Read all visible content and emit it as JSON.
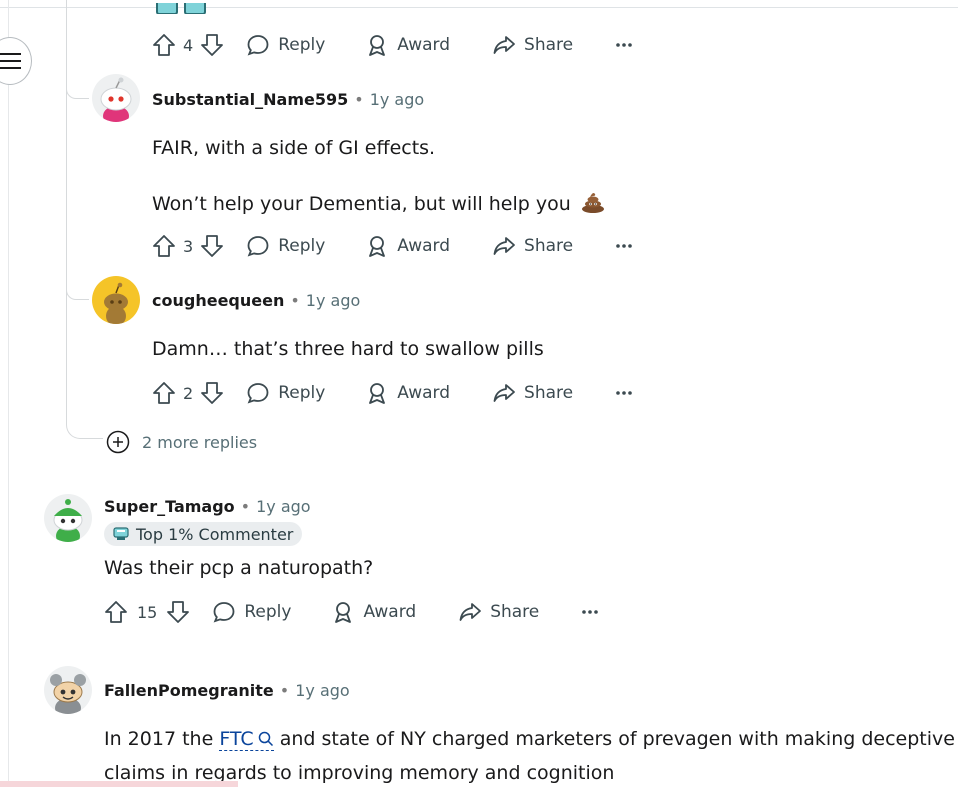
{
  "nav": {
    "menu_icon": "hamburger-icon"
  },
  "comments": [
    {
      "vote_count": "4",
      "actions": {
        "reply": "Reply",
        "award": "Award",
        "share": "Share"
      }
    },
    {
      "username": "Substantial_Name595",
      "separator": "•",
      "time": "1y ago",
      "paragraphs": [
        "FAIR, with a side of GI effects.",
        "Won’t help your Dementia, but will help you"
      ],
      "emoji": "💩",
      "vote_count": "3",
      "actions": {
        "reply": "Reply",
        "award": "Award",
        "share": "Share"
      }
    },
    {
      "username": "cougheequeen",
      "separator": "•",
      "time": "1y ago",
      "paragraphs": [
        "Damn… that’s three hard to swallow pills"
      ],
      "vote_count": "2",
      "actions": {
        "reply": "Reply",
        "award": "Award",
        "share": "Share"
      }
    },
    {
      "username": "Super_Tamago",
      "separator": "•",
      "time": "1y ago",
      "badge": "Top 1% Commenter",
      "paragraphs": [
        "Was their pcp a naturopath?"
      ],
      "vote_count": "15",
      "actions": {
        "reply": "Reply",
        "award": "Award",
        "share": "Share"
      }
    },
    {
      "username": "FallenPomegranite",
      "separator": "•",
      "time": "1y ago",
      "text_before_link": "In 2017 the",
      "link_text": "FTC",
      "text_after_link": "and state of NY charged marketers of prevagen with making deceptive",
      "text_line2": "claims in regards to improving memory and cognition"
    }
  ],
  "more_replies": "2 more replies",
  "colors": {
    "accent_link": "#0a449b",
    "avatar_yellow": "#f5c428",
    "meta_text": "#576f76"
  }
}
